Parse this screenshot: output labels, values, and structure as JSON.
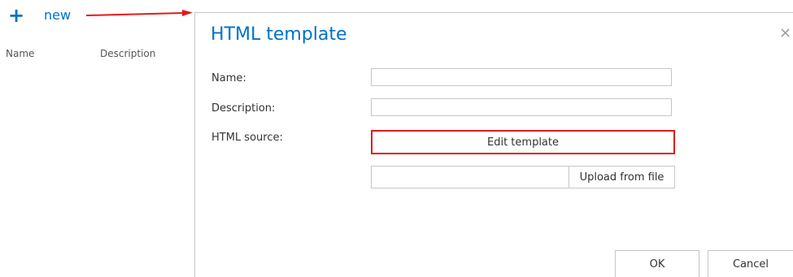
{
  "toolbar": {
    "new_label": "new",
    "plus_glyph": "+"
  },
  "list": {
    "columns": [
      "Name",
      "Description"
    ]
  },
  "dialog": {
    "title": "HTML template",
    "close_glyph": "×",
    "fields": {
      "name_label": "Name:",
      "name_value": "",
      "description_label": "Description:",
      "description_value": "",
      "html_source_label": "HTML source:"
    },
    "edit_template_label": "Edit template",
    "upload_path_value": "",
    "upload_label": "Upload from file",
    "ok_label": "OK",
    "cancel_label": "Cancel"
  },
  "colors": {
    "accent": "#0072c6",
    "highlight": "#e21a1a",
    "border": "#c6c6c6"
  },
  "icons": {
    "plus": "plus-icon",
    "close": "close-icon",
    "arrow": "red-arrow-icon"
  }
}
